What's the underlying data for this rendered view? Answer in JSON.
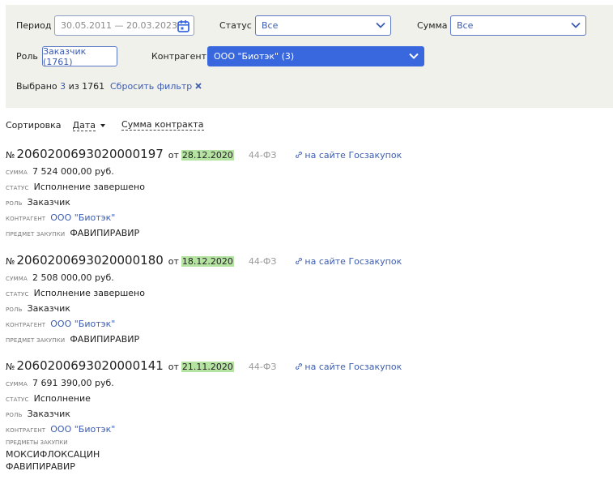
{
  "filters": {
    "period_label": "Период",
    "period_value": "30.05.2011 — 20.03.2023",
    "status_label": "Статус",
    "status_value": "Все",
    "amount_label": "Сумма",
    "amount_value": "Все",
    "role_label": "Роль",
    "role_chip": "Заказчик (1761)",
    "counterparty_label": "Контрагент",
    "counterparty_value": "ООО \"Биотэк\" (3)",
    "selected_prefix": "Выбрано",
    "selected_count": "3",
    "selected_suffix": "из 1761",
    "reset_label": "Сбросить фильтр",
    "accent_color": "#3867de"
  },
  "sort": {
    "label": "Сортировка",
    "options": [
      "Дата",
      "Сумма контракта"
    ]
  },
  "contracts": [
    {
      "no_prefix": "№",
      "number": "2060200693020000197",
      "ot": "от",
      "date": "28.12.2020",
      "law": "44-ФЗ",
      "link": "на сайте Госзакупок",
      "sum_key": "сумма",
      "sum": "7 524 000,00 руб.",
      "status_key": "статус",
      "status": "Исполнение завершено",
      "role_key": "роль",
      "role": "Заказчик",
      "counterparty_key": "контрагент",
      "counterparty": "ООО \"Биотэк\"",
      "subject_key": "предмет закупки",
      "subject": "ФАВИПИРАВИР"
    },
    {
      "no_prefix": "№",
      "number": "2060200693020000180",
      "ot": "от",
      "date": "18.12.2020",
      "law": "44-ФЗ",
      "link": "на сайте Госзакупок",
      "sum_key": "сумма",
      "sum": "2 508 000,00 руб.",
      "status_key": "статус",
      "status": "Исполнение завершено",
      "role_key": "роль",
      "role": "Заказчик",
      "counterparty_key": "контрагент",
      "counterparty": "ООО \"Биотэк\"",
      "subject_key": "предмет закупки",
      "subject": "ФАВИПИРАВИР"
    },
    {
      "no_prefix": "№",
      "number": "2060200693020000141",
      "ot": "от",
      "date": "21.11.2020",
      "law": "44-ФЗ",
      "link": "на сайте Госзакупок",
      "sum_key": "сумма",
      "sum": "7 691 390,00 руб.",
      "status_key": "статус",
      "status": "Исполнение",
      "role_key": "роль",
      "role": "Заказчик",
      "counterparty_key": "контрагент",
      "counterparty": "ООО \"Биотэк\"",
      "subjects_key": "предметы закупки",
      "subjects": [
        "МОКСИФЛОКСАЦИН",
        "ФАВИПИРАВИР"
      ]
    }
  ]
}
